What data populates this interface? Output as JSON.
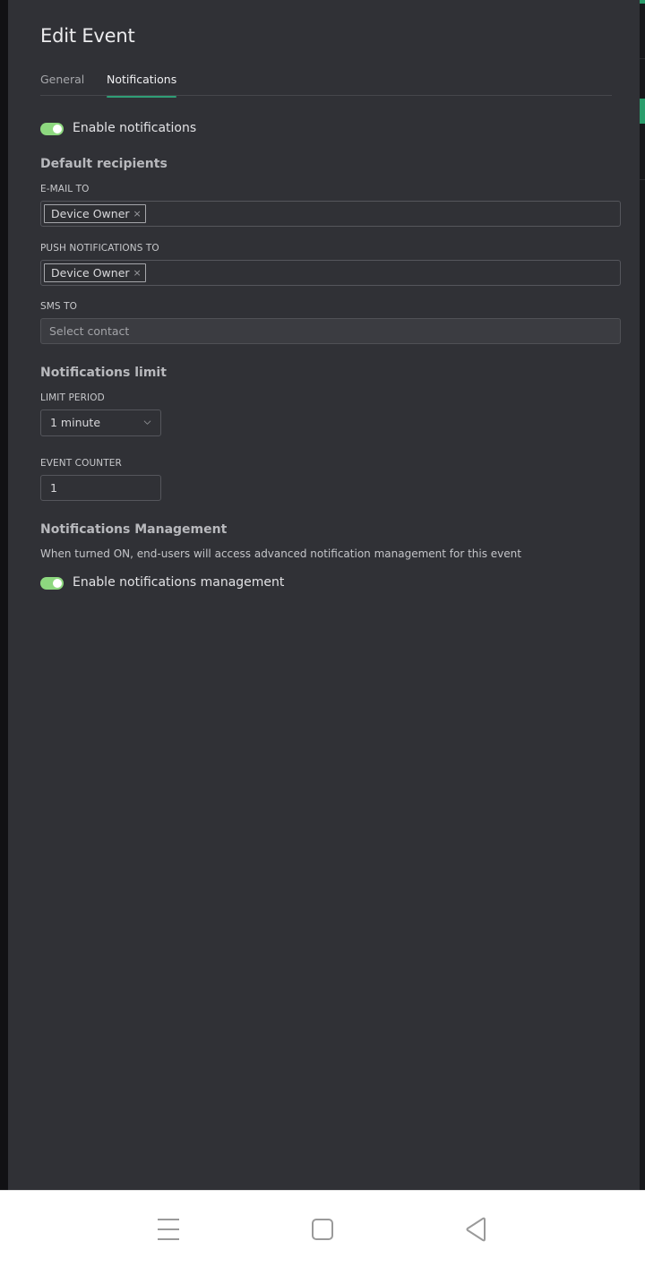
{
  "dialog": {
    "title": "Edit Event",
    "tabs": [
      {
        "label": "General",
        "active": false
      },
      {
        "label": "Notifications",
        "active": true
      }
    ]
  },
  "notifications": {
    "enable_toggle": {
      "label": "Enable notifications",
      "on": true
    },
    "default_recipients": {
      "title": "Default recipients",
      "email": {
        "label": "E-MAIL TO",
        "chips": [
          "Device Owner"
        ]
      },
      "push": {
        "label": "PUSH NOTIFICATIONS TO",
        "chips": [
          "Device Owner"
        ]
      },
      "sms": {
        "label": "SMS TO",
        "placeholder": "Select contact"
      }
    },
    "limit": {
      "title": "Notifications limit",
      "period_label": "LIMIT PERIOD",
      "period_value": "1 minute",
      "counter_label": "EVENT COUNTER",
      "counter_value": "1"
    },
    "management": {
      "title": "Notifications Management",
      "description": "When turned ON, end-users will access advanced notification management for this event",
      "toggle": {
        "label": "Enable notifications management",
        "on": true
      }
    }
  },
  "chip_remove_glyph": "×",
  "colors": {
    "panel_bg": "#303136",
    "accent_tab": "#2f9e76",
    "toggle_on": "#8dd87f"
  },
  "system_nav": {
    "icons": [
      "menu-icon",
      "home-icon",
      "back-icon"
    ]
  }
}
